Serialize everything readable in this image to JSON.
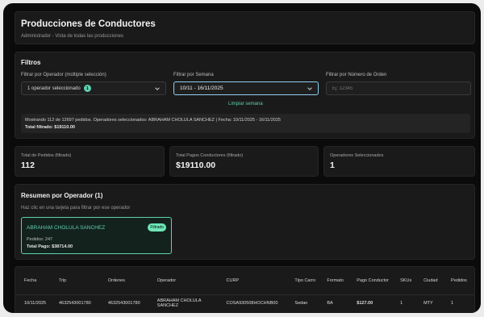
{
  "header": {
    "title": "Producciones de Conductores",
    "subtitle": "Administrador - Vista de todas las producciones"
  },
  "filters": {
    "title": "Filtros",
    "operator_label": "Filtrar por Operador (múltiple selección)",
    "operator_value": "1 operador seleccionado",
    "operator_count": "1",
    "week_label": "Filtrar por Semana",
    "week_value": "10/11 - 16/11/2025",
    "clear_week": "Limpiar semana",
    "order_label": "Filtrar por Número de Orden",
    "order_placeholder": "Ej: 12345",
    "summary_line1": "Mostrando 112 de 12697 pedidos. Operadores seleccionados: ABRAHAM CHOLULA SANCHEZ | Fecha: 10/11/2025 - 16/11/2025",
    "summary_line2": "Total filtrado: $19110.00"
  },
  "stats": [
    {
      "label": "Total de Pedidos (filtrado)",
      "value": "112"
    },
    {
      "label": "Total Pagos Conductores (filtrado)",
      "value": "$19110.00"
    },
    {
      "label": "Operadores Seleccionados",
      "value": "1"
    }
  ],
  "summary": {
    "title": "Resumen por Operador (1)",
    "hint": "Haz clic en una tarjeta para filtrar por ese operador",
    "card": {
      "name": "ABRAHAM CHOLULA SANCHEZ",
      "badge": "Filtrado",
      "orders": "Pedidos: 247",
      "total": "Total Pago: $38714.00"
    }
  },
  "table": {
    "headers": [
      "Fecha",
      "Trip",
      "Ordenes",
      "Operador",
      "CURP",
      "Tipo Carro",
      "Formato",
      "Pago Conductor",
      "SKUs",
      "Ciudad",
      "Pedidos"
    ],
    "rows": [
      [
        "10/11/2025",
        "4632543001780",
        "4632543001780",
        "ABRAHAM CHOLULA SANCHEZ",
        "COSA930508HOCHNB00",
        "Sedan",
        "BA",
        "$127.00",
        "1",
        "MTY",
        "1"
      ]
    ]
  },
  "colors": {
    "accent": "#5fd1b0",
    "badge_bg": "#6ee7b7",
    "focus_border": "#8fd0f0"
  }
}
